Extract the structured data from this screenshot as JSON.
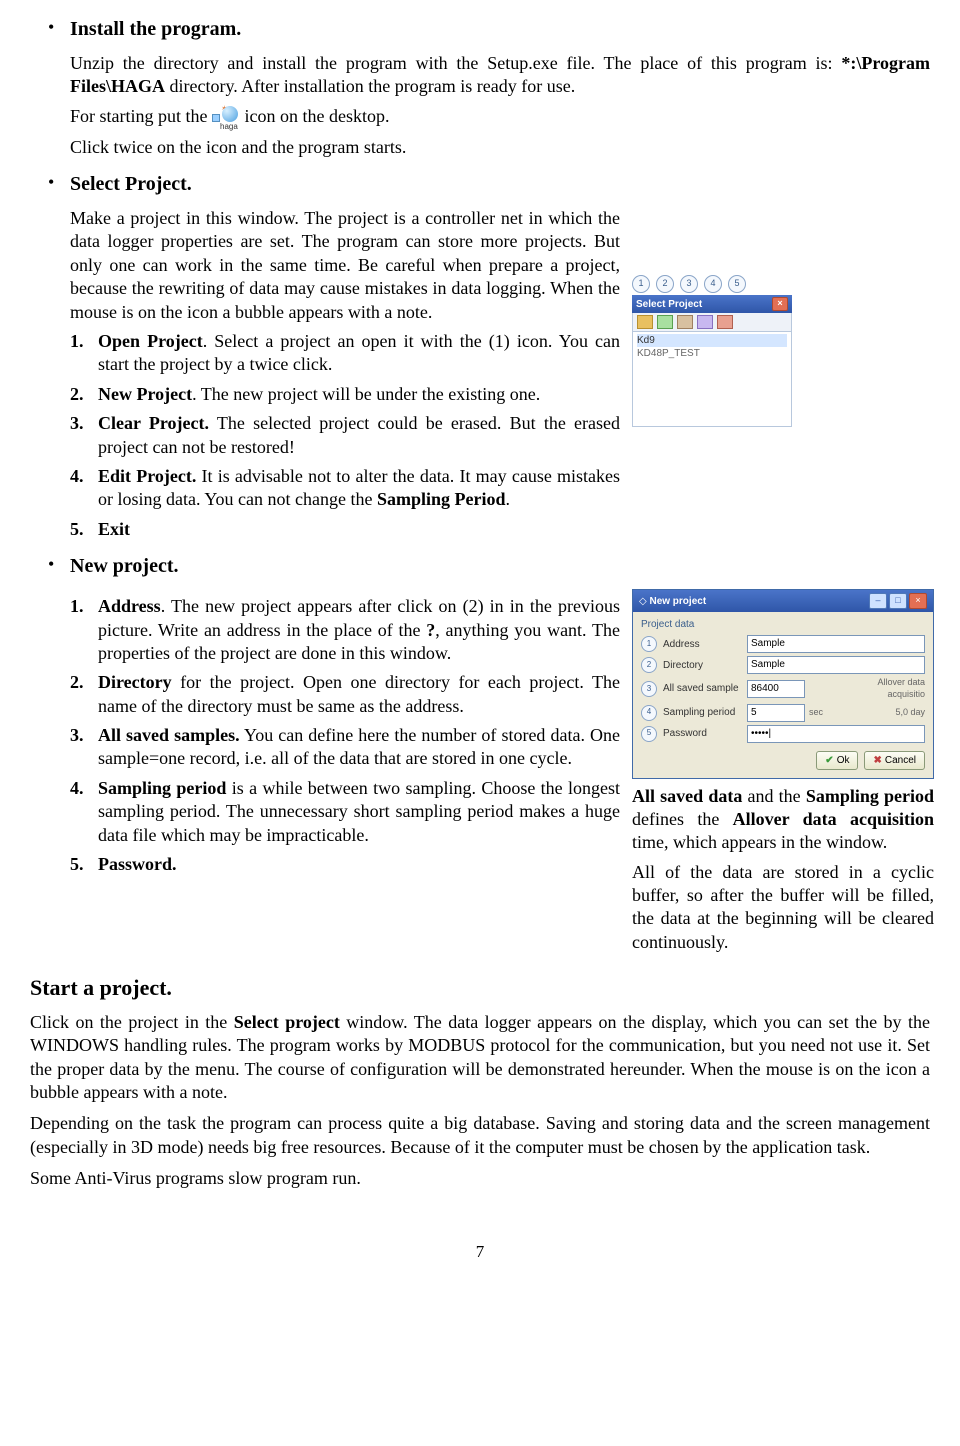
{
  "s1": {
    "heading": "Install the program.",
    "p1a": "Unzip the directory and install the program with the Setup.exe file. The place of this program is: ",
    "p1b": "*:\\Program Files\\HAGA",
    "p1c": " directory. After installation the program is ready for use.",
    "p2a": "For starting put the ",
    "haga_label": "haga",
    "p2b": " icon on the desktop.",
    "p3": "Click twice on the icon and the program starts."
  },
  "s2": {
    "heading": "Select Project.",
    "intro": "Make a project in this window. The project is a controller net in which the data logger properties are set. The program can store more projects. But only one can work in the same time. Be careful when prepare a project, because the rewriting of data may cause mistakes in data logging. When the mouse is on the icon a bubble appears with a note.",
    "items": [
      {
        "n": "1.",
        "b": "Open Project",
        "t": ". Select a project an open it with the (1) icon. You can start the project by a twice click."
      },
      {
        "n": "2.",
        "b": "New Project",
        "t": ". The new project will be under the existing one."
      },
      {
        "n": "3.",
        "b": "Clear Project.",
        "t": " The selected project could be erased. But the erased project can not be restored!"
      },
      {
        "n": "4.",
        "b": "Edit Project.",
        "t": " It is advisable not to alter the data. It may cause mistakes or losing data. You can not change the ",
        "b2": "Sampling Period",
        "t2": "."
      },
      {
        "n": "5.",
        "b": "Exit",
        "t": ""
      }
    ],
    "panel": {
      "nums": [
        "1",
        "2",
        "3",
        "4",
        "5"
      ],
      "title": "Select Project",
      "list": [
        "Kd9",
        "KD48P_TEST"
      ]
    }
  },
  "s3": {
    "heading": "New project.",
    "items": [
      {
        "n": "1.",
        "b": "Address",
        "t": ". The new project appears after click on (2) in in the previous picture. Write an address in the place of the ",
        "b2": "?",
        "t2": ", anything you want. The properties of the project are done in this window."
      },
      {
        "n": "2.",
        "b": "Directory",
        "t": " for the project. Open one directory for each project. The name of the directory must be same as the address."
      },
      {
        "n": "3.",
        "b": "All saved samples.",
        "t": " You can define here the number of stored data. One sample=one record, i.e. all of the data that are stored in one cycle."
      },
      {
        "n": "4.",
        "b": "Sampling period",
        "t": " is a while between two sampling. Choose the longest sampling period. The unnecessary short sampling period makes a huge data file which may be impracticable."
      },
      {
        "n": "5.",
        "b": "Password.",
        "t": ""
      }
    ],
    "dialog": {
      "title": "New project",
      "group": "Project data",
      "rows": [
        {
          "n": "1",
          "lbl": "Address",
          "val": "Sample",
          "unit": ""
        },
        {
          "n": "2",
          "lbl": "Directory",
          "val": "Sample",
          "unit": ""
        },
        {
          "n": "3",
          "lbl": "All saved sample",
          "val": "86400",
          "unit": ""
        },
        {
          "n": "4",
          "lbl": "Sampling period",
          "val": "5",
          "unit": "sec"
        },
        {
          "n": "5",
          "lbl": "Password",
          "val": "•••••|",
          "unit": ""
        }
      ],
      "allover_lbl": "Allover data acquisitio",
      "allover_val": "5,0  day",
      "ok": "Ok",
      "cancel": "Cancel"
    },
    "right_notes": {
      "p1a": "All saved data",
      "p1b": " and the ",
      "p1c": "Sampling period",
      "p1d": " defines the ",
      "p1e": "Allover data acquisition",
      "p1f": " time, which appears in the window.",
      "p2": "All of the data are stored in a cyclic buffer, so after the buffer will be filled, the data at the beginning will be cleared continuously."
    }
  },
  "s4": {
    "heading": "Start a project.",
    "p1a": "Click on the project in the ",
    "p1b": "Select project",
    "p1c": " window. The data logger appears on the display, which you can set the by the WINDOWS handling rules. The program works by MODBUS protocol for the communication, but you need not use it. Set the proper data by the menu. The course of configuration will be demonstrated hereunder. When the mouse is on the icon a bubble appears with a note.",
    "p2": "Depending on the task the program can process quite a big database. Saving and storing data and the screen management (especially in 3D mode) needs big free resources. Because of it the computer must be chosen by the application task.",
    "p3": "Some Anti-Virus programs slow program run."
  },
  "page_num": "7"
}
